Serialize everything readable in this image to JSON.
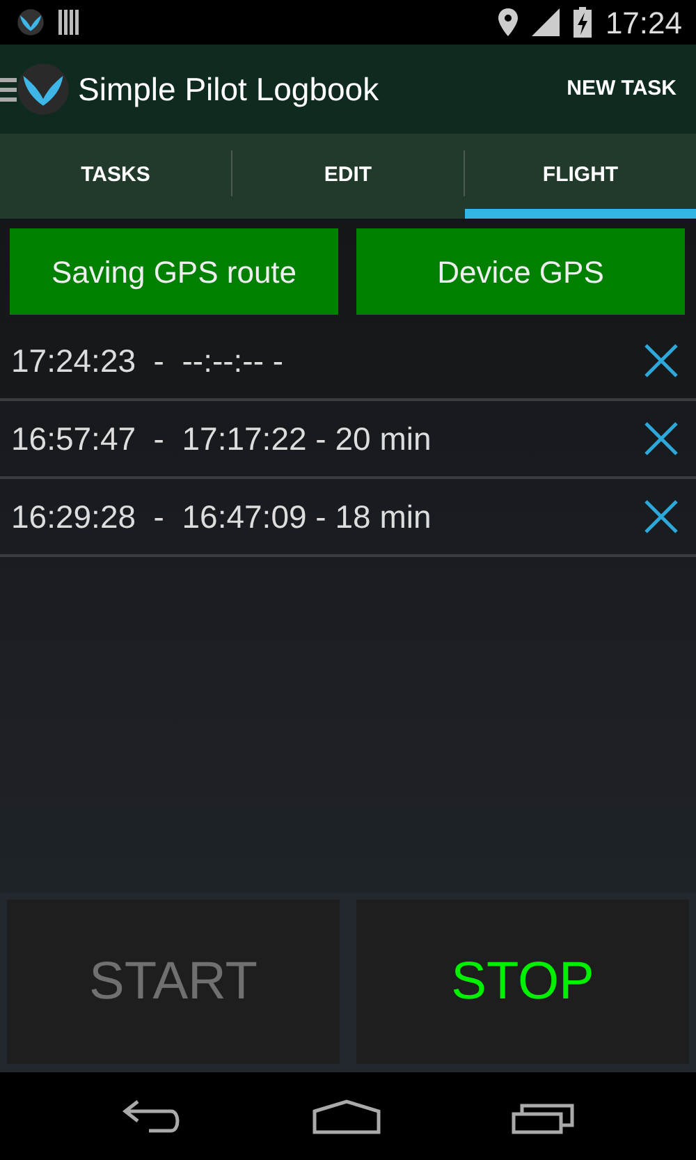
{
  "status_bar": {
    "time": "17:24"
  },
  "action_bar": {
    "title": "Simple Pilot Logbook",
    "action": "NEW TASK"
  },
  "tabs": [
    {
      "label": "TASKS",
      "selected": false
    },
    {
      "label": "EDIT",
      "selected": false
    },
    {
      "label": "FLIGHT",
      "selected": true
    }
  ],
  "gps_buttons": [
    "Saving GPS route",
    "Device GPS"
  ],
  "flights": [
    {
      "text": "17:24:23  -  --:--:-- -"
    },
    {
      "text": "16:57:47  -  17:17:22 - 20 min"
    },
    {
      "text": "16:29:28  -  16:47:09 - 18 min"
    }
  ],
  "controls": [
    {
      "label": "START",
      "disabled": true
    },
    {
      "label": "STOP",
      "disabled": false
    }
  ]
}
